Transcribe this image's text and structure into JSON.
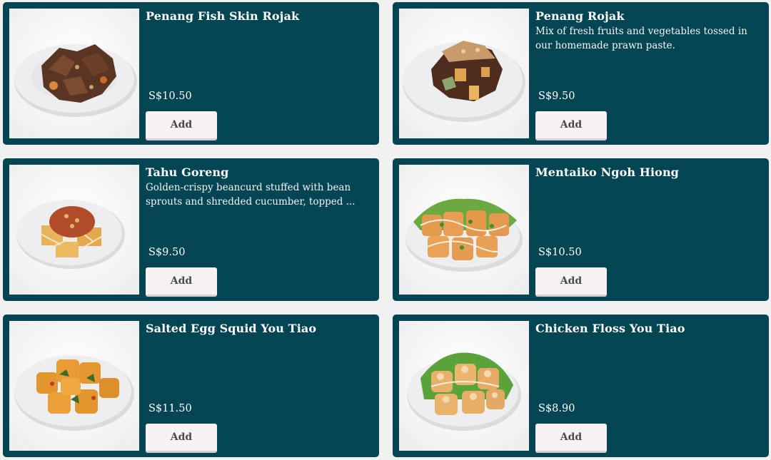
{
  "items": [
    {
      "name": "Penang Fish Skin Rojak",
      "description": "",
      "price": "S$10.50",
      "add_label": "Add",
      "image_icon": "fish-skin-rojak-dish-image"
    },
    {
      "name": "Penang Rojak",
      "description": "Mix of fresh fruits and vegetables tossed in our homemade prawn paste.",
      "price": "S$9.50",
      "add_label": "Add",
      "image_icon": "penang-rojak-dish-image"
    },
    {
      "name": "Tahu Goreng",
      "description": "Golden-crispy beancurd stuffed with bean sprouts and shredded cucumber, topped ...",
      "price": "S$9.50",
      "add_label": "Add",
      "image_icon": "tahu-goreng-dish-image"
    },
    {
      "name": "Mentaiko Ngoh Hiong",
      "description": "",
      "price": "S$10.50",
      "add_label": "Add",
      "image_icon": "mentaiko-ngoh-hiong-dish-image"
    },
    {
      "name": "Salted Egg Squid You Tiao",
      "description": "",
      "price": "S$11.50",
      "add_label": "Add",
      "image_icon": "salted-egg-squid-dish-image"
    },
    {
      "name": "Chicken Floss You Tiao",
      "description": "",
      "price": "S$8.90",
      "add_label": "Add",
      "image_icon": "chicken-floss-you-tiao-dish-image"
    }
  ],
  "colors": {
    "card_background": "#034552",
    "page_background": "#f1f1f1",
    "button_background": "#f7f2f4",
    "text": "#ffffff"
  }
}
